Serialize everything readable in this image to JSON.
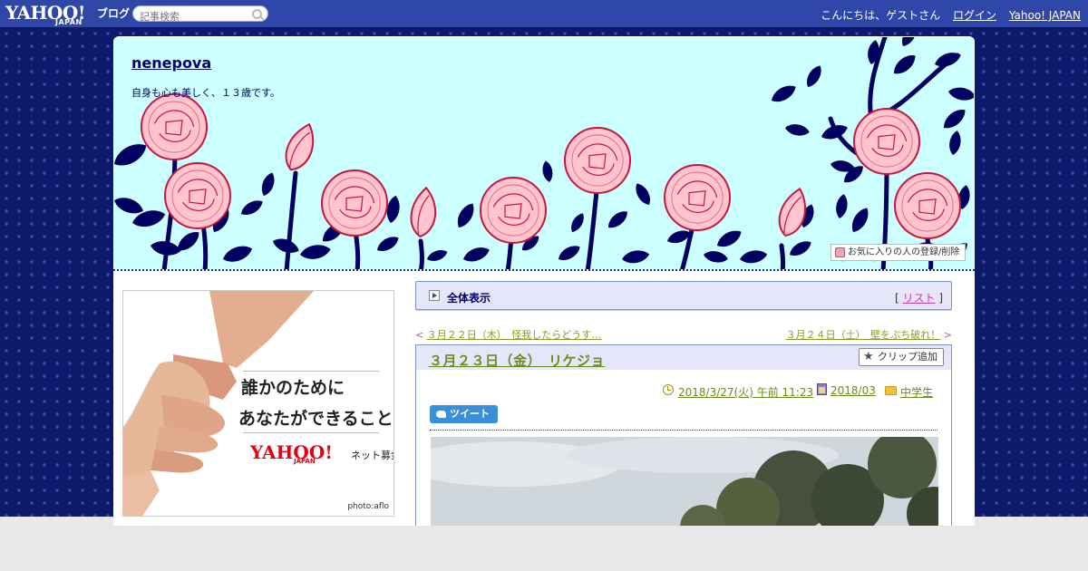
{
  "topbar": {
    "logo_text": "YAHOO!",
    "logo_sub": "JAPAN",
    "service_name": "ブログ",
    "search_placeholder": "記事検索",
    "greeting": "こんにちは、ゲストさん",
    "login_label": "ログイン",
    "yahoo_japan_label": "Yahoo! JAPAN"
  },
  "blog": {
    "title": "nenepova",
    "description": "自身も心も美しく、１３歳です。",
    "favorite_button": "お気に入りの人の登録/削除"
  },
  "ad": {
    "line1": "誰かのために",
    "line2": "あなたができること",
    "logo": "YAHOO!",
    "logo_sub": "JAPAN",
    "service": "ネット募金",
    "credit": "photo:aflo"
  },
  "section": {
    "title": "全体表示",
    "list_open": "[ ",
    "list_label": "リスト",
    "list_close": " ]"
  },
  "nav": {
    "prev_prefix": "< ",
    "prev_label": "３月２２日（木）　怪我したらどうす…",
    "next_label": "３月２４日（土）　壁をぶち破れ！",
    "next_suffix": " >"
  },
  "article": {
    "title": "３月２３日（金）　リケジョ",
    "clip_button": "クリップ追加",
    "datetime": "2018/3/27(火) 午前 11:23",
    "month": "2018/03",
    "category": "中学生",
    "tweet_button": "ツイート"
  },
  "colors": {
    "topbar": "#2f47a8",
    "header_bg": "#ccffff",
    "link_green": "#6b8b1f",
    "title_navy": "#000066",
    "rose_pink": "#ffc4ce",
    "rose_stroke": "#c8163d"
  }
}
